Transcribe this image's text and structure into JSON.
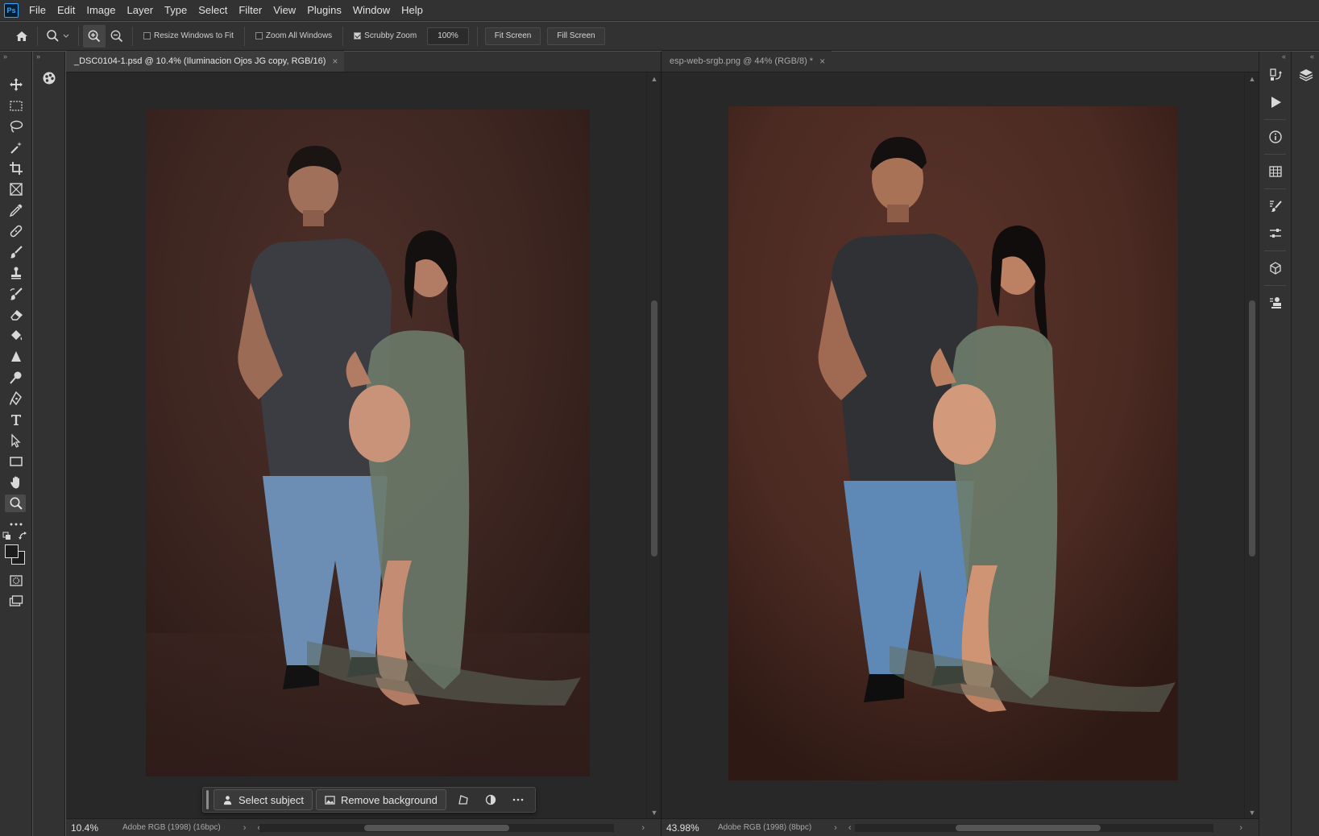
{
  "app": {
    "logo": "Ps"
  },
  "menu": [
    "File",
    "Edit",
    "Image",
    "Layer",
    "Type",
    "Select",
    "Filter",
    "View",
    "Plugins",
    "Window",
    "Help"
  ],
  "options": {
    "resize_windows": "Resize Windows to Fit",
    "resize_windows_checked": false,
    "zoom_all": "Zoom All Windows",
    "zoom_all_checked": false,
    "scrubby_zoom": "Scrubby Zoom",
    "scrubby_zoom_checked": true,
    "zoom_value": "100%",
    "fit_screen": "Fit Screen",
    "fill_screen": "Fill Screen"
  },
  "documents": [
    {
      "tab_title": "_DSC0104-1.psd @ 10.4% (Iluminacion Ojos JG copy, RGB/16)",
      "close": "×",
      "zoom": "10.4%",
      "profile": "Adobe RGB (1998) (16bpc)",
      "active": true
    },
    {
      "tab_title": "esp-web-srgb.png @ 44% (RGB/8) *",
      "close": "×",
      "zoom": "43.98%",
      "profile": "Adobe RGB (1998) (8bpc)",
      "active": false
    }
  ],
  "taskbar": {
    "select_subject": "Select subject",
    "remove_background": "Remove background"
  },
  "colors": {
    "backdrop_left": "#3f2722",
    "backdrop_right": "#4a2a22",
    "accent": "#31a8ff"
  },
  "icons": {
    "tools": [
      "move-icon",
      "marquee-icon",
      "lasso-icon",
      "magic-wand-icon",
      "crop-icon",
      "frame-icon",
      "eyedropper-icon",
      "healing-brush-icon",
      "brush-icon",
      "clone-stamp-icon",
      "history-brush-icon",
      "eraser-icon",
      "paint-bucket-icon",
      "blur-icon",
      "dodge-icon",
      "pen-icon",
      "type-icon",
      "path-selection-icon",
      "rectangle-icon",
      "hand-icon",
      "zoom-icon",
      "more-tools-icon"
    ],
    "dock": [
      "history-icon",
      "actions-icon",
      "info-icon",
      "swatches-icon",
      "brushes-icon",
      "adjustments-icon",
      "3d-icon",
      "stamp-panel-icon",
      "layers-icon"
    ]
  }
}
